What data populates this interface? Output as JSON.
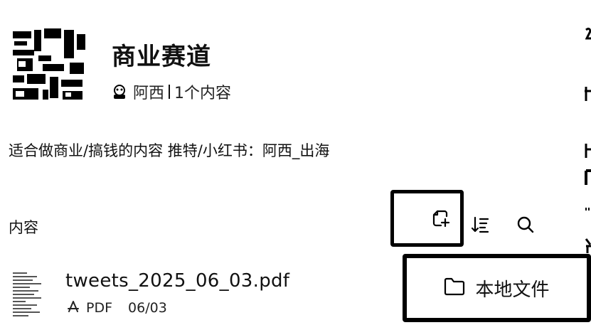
{
  "collection": {
    "title": "商业赛道",
    "author": "阿西",
    "count": "1个内容",
    "description": "适合做商业/搞钱的内容 推特/小红书：阿西_出海"
  },
  "section": {
    "label": "内容"
  },
  "toolbar": {
    "add_icon": "add-file-icon",
    "sort_icon": "sort-icon",
    "search_icon": "search-icon"
  },
  "popup": {
    "option_label": "本地文件",
    "option_icon": "folder-icon"
  },
  "file": {
    "name": "tweets_2025_06_03.pdf",
    "type": "PDF",
    "date": "06/03"
  }
}
